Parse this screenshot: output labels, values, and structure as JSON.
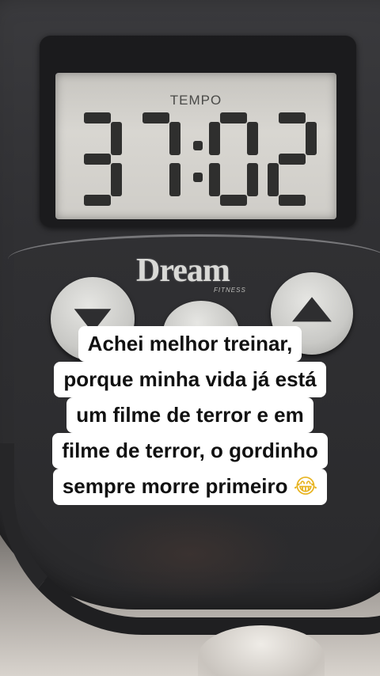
{
  "display": {
    "label": "TEMPO",
    "time": "37:02"
  },
  "brand": {
    "logo": "Dream",
    "sub": "FITNESS"
  },
  "caption": {
    "lines": [
      "Achei melhor treinar,",
      "porque minha vida já está",
      "um filme de terror e em",
      "filme de terror, o gordinho",
      "sempre morre primeiro"
    ],
    "emoji": "😂"
  },
  "icons": {
    "down": "triangle-down-icon",
    "up": "triangle-up-icon",
    "emoji": "laughing-tears-emoji-icon"
  }
}
